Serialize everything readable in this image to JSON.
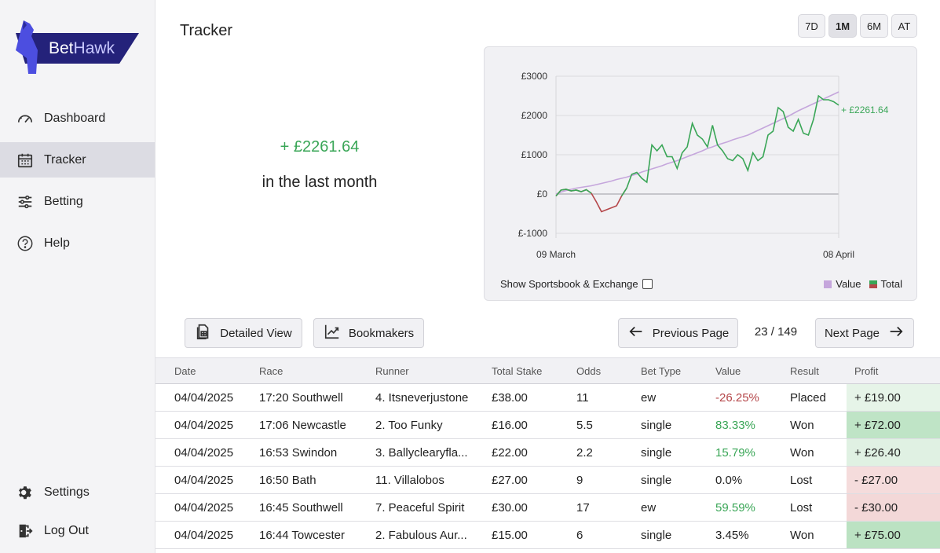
{
  "brand": {
    "name_part1": "Bet",
    "name_part2": "Hawk"
  },
  "sidebar": {
    "items": [
      {
        "label": "Dashboard",
        "icon": "gauge-icon"
      },
      {
        "label": "Tracker",
        "icon": "calendar-icon",
        "active": true
      },
      {
        "label": "Betting",
        "icon": "sliders-icon"
      },
      {
        "label": "Help",
        "icon": "help-icon"
      }
    ],
    "bottom": [
      {
        "label": "Settings",
        "icon": "gear-icon"
      },
      {
        "label": "Log Out",
        "icon": "logout-icon"
      }
    ]
  },
  "page": {
    "title": "Tracker"
  },
  "summary": {
    "value": "+ £2261.64",
    "label": "in the last month"
  },
  "ranges": [
    {
      "label": "7D"
    },
    {
      "label": "1M",
      "active": true
    },
    {
      "label": "6M"
    },
    {
      "label": "AT"
    }
  ],
  "chart": {
    "end_label": "+ £2261.64",
    "toggle_label": "Show Sportsbook & Exchange",
    "toggle_checked": false,
    "legend": {
      "value_label": "Value",
      "total_label": "Total"
    }
  },
  "chart_data": {
    "type": "line",
    "x_ticks": [
      "09 March",
      "08 April"
    ],
    "y_ticks": [
      "£3000",
      "£2000",
      "£1000",
      "£0",
      "£-1000"
    ],
    "ylim": [
      -1000,
      3000
    ],
    "grid": true,
    "legend_position": "bottom-right",
    "colors": {
      "value": "#c5a6dc",
      "total_positive": "#3aa657",
      "total_negative": "#b5474a"
    },
    "series": [
      {
        "name": "Value",
        "values": [
          0,
          50,
          90,
          120,
          150,
          170,
          190,
          210,
          240,
          270,
          300,
          330,
          370,
          400,
          430,
          470,
          510,
          560,
          600,
          640,
          680,
          720,
          770,
          810,
          850,
          900,
          950,
          1000,
          1050,
          1100,
          1160,
          1200,
          1250,
          1290,
          1330,
          1380,
          1420,
          1460,
          1500,
          1560,
          1620,
          1680,
          1740,
          1800,
          1860,
          1920,
          1980,
          2050,
          2120,
          2180,
          2240,
          2300,
          2360,
          2420,
          2480,
          2540,
          2600
        ]
      },
      {
        "name": "Total",
        "values": [
          -50,
          100,
          120,
          80,
          100,
          60,
          110,
          20,
          -200,
          -450,
          -400,
          -350,
          -300,
          -50,
          150,
          500,
          550,
          400,
          300,
          1250,
          1100,
          1250,
          950,
          950,
          650,
          1050,
          1200,
          1800,
          1500,
          1400,
          1200,
          1750,
          1250,
          1100,
          900,
          850,
          1000,
          900,
          600,
          1050,
          850,
          950,
          1500,
          1600,
          2200,
          2100,
          1700,
          1600,
          1900,
          1550,
          1500,
          1900,
          2500,
          2400,
          2400,
          2350,
          2261.64
        ]
      }
    ]
  },
  "toolbar": {
    "detailed_view": "Detailed View",
    "bookmakers": "Bookmakers"
  },
  "pagination": {
    "prev": "Previous Page",
    "next": "Next Page",
    "label": "23 / 149"
  },
  "table": {
    "columns": [
      "Date",
      "Race",
      "Runner",
      "Total Stake",
      "Odds",
      "Bet Type",
      "Value",
      "Result",
      "Profit"
    ],
    "rows": [
      {
        "date": "04/04/2025",
        "race": "17:20 Southwell",
        "runner": "4. Itsneverjustone",
        "stake": "£38.00",
        "odds": "11",
        "bet_type": "ew",
        "value": "-26.25%",
        "value_sign": "neg",
        "result": "Placed",
        "profit": "+ £19.00",
        "profit_bg": "#e6f4e8"
      },
      {
        "date": "04/04/2025",
        "race": "17:06 Newcastle",
        "runner": "2. Too Funky",
        "stake": "£16.00",
        "odds": "5.5",
        "bet_type": "single",
        "value": "83.33%",
        "value_sign": "pos",
        "result": "Won",
        "profit": "+ £72.00",
        "profit_bg": "#bfe4c6"
      },
      {
        "date": "04/04/2025",
        "race": "16:53 Swindon",
        "runner": "3. Ballyclearyfla...",
        "stake": "£22.00",
        "odds": "2.2",
        "bet_type": "single",
        "value": "15.79%",
        "value_sign": "pos",
        "result": "Won",
        "profit": "+ £26.40",
        "profit_bg": "#e0f1e3"
      },
      {
        "date": "04/04/2025",
        "race": "16:50 Bath",
        "runner": "11. Villalobos",
        "stake": "£27.00",
        "odds": "9",
        "bet_type": "single",
        "value": "0.0%",
        "value_sign": "zero",
        "result": "Lost",
        "profit": "- £27.00",
        "profit_bg": "#f5dcdc"
      },
      {
        "date": "04/04/2025",
        "race": "16:45 Southwell",
        "runner": "7. Peaceful Spirit",
        "stake": "£30.00",
        "odds": "17",
        "bet_type": "ew",
        "value": "59.59%",
        "value_sign": "pos",
        "result": "Lost",
        "profit": "- £30.00",
        "profit_bg": "#f3d8d8"
      },
      {
        "date": "04/04/2025",
        "race": "16:44 Towcester",
        "runner": "2. Fabulous Aur...",
        "stake": "£15.00",
        "odds": "6",
        "bet_type": "single",
        "value": "3.45%",
        "value_sign": "zero",
        "result": "Won",
        "profit": "+ £75.00",
        "profit_bg": "#bbe2c2"
      }
    ]
  }
}
